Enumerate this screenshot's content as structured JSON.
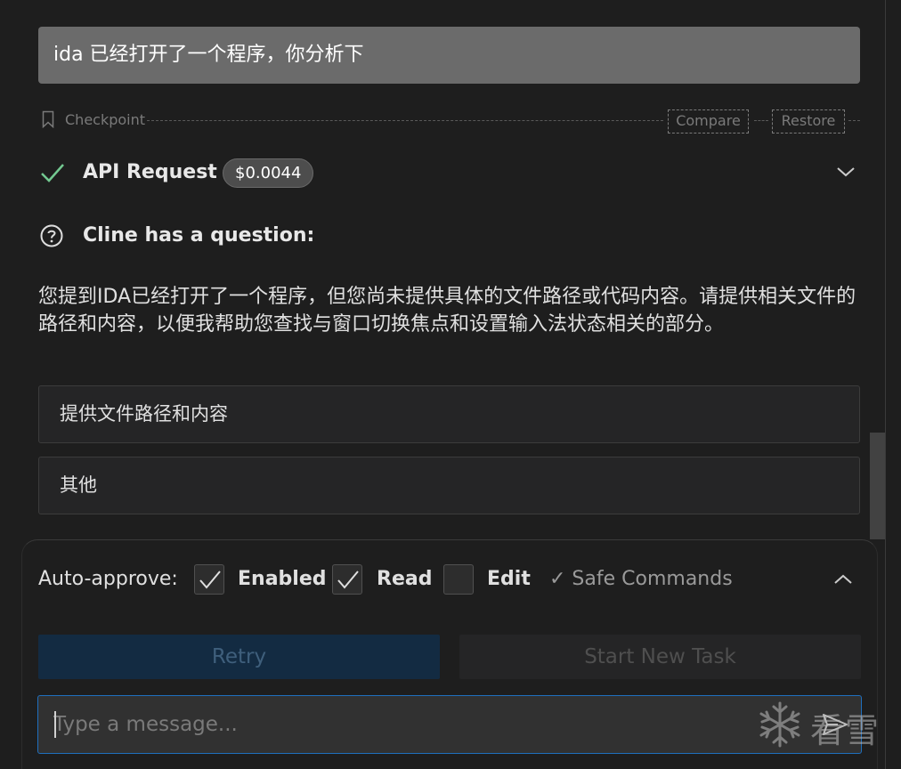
{
  "user_message": "ida 已经打开了一个程序，你分析下",
  "checkpoint": {
    "label": "Checkpoint",
    "compare_label": "Compare",
    "restore_label": "Restore"
  },
  "api_request": {
    "label": "API Request",
    "cost": "$0.0044"
  },
  "question": {
    "title": "Cline has a question:",
    "text": "您提到IDA已经打开了一个程序，但您尚未提供具体的文件路径或代码内容。请提供相关文件的路径和内容，以便我帮助您查找与窗口切换焦点和设置输入法状态相关的部分。",
    "options": [
      "提供文件路径和内容",
      "其他"
    ]
  },
  "auto_approve": {
    "label": "Auto-approve:",
    "items": [
      {
        "label": "Enabled",
        "checked": true
      },
      {
        "label": "Read",
        "checked": true
      },
      {
        "label": "Edit",
        "checked": false
      }
    ],
    "safe_commands_label": "✓ Safe Commands"
  },
  "actions": {
    "retry_label": "Retry",
    "new_task_label": "Start New Task"
  },
  "input": {
    "placeholder": "Type a message...",
    "value": ""
  },
  "watermark": {
    "text": "看雪"
  },
  "icons": {
    "checkpoint": "bookmark-icon",
    "api_status": "check-icon",
    "question": "question-circle-icon",
    "send": "send-icon",
    "watermark": "snowflake-icon"
  },
  "colors": {
    "background": "#1e1e1e",
    "accent": "#1f6fbe",
    "success": "#73c991"
  }
}
